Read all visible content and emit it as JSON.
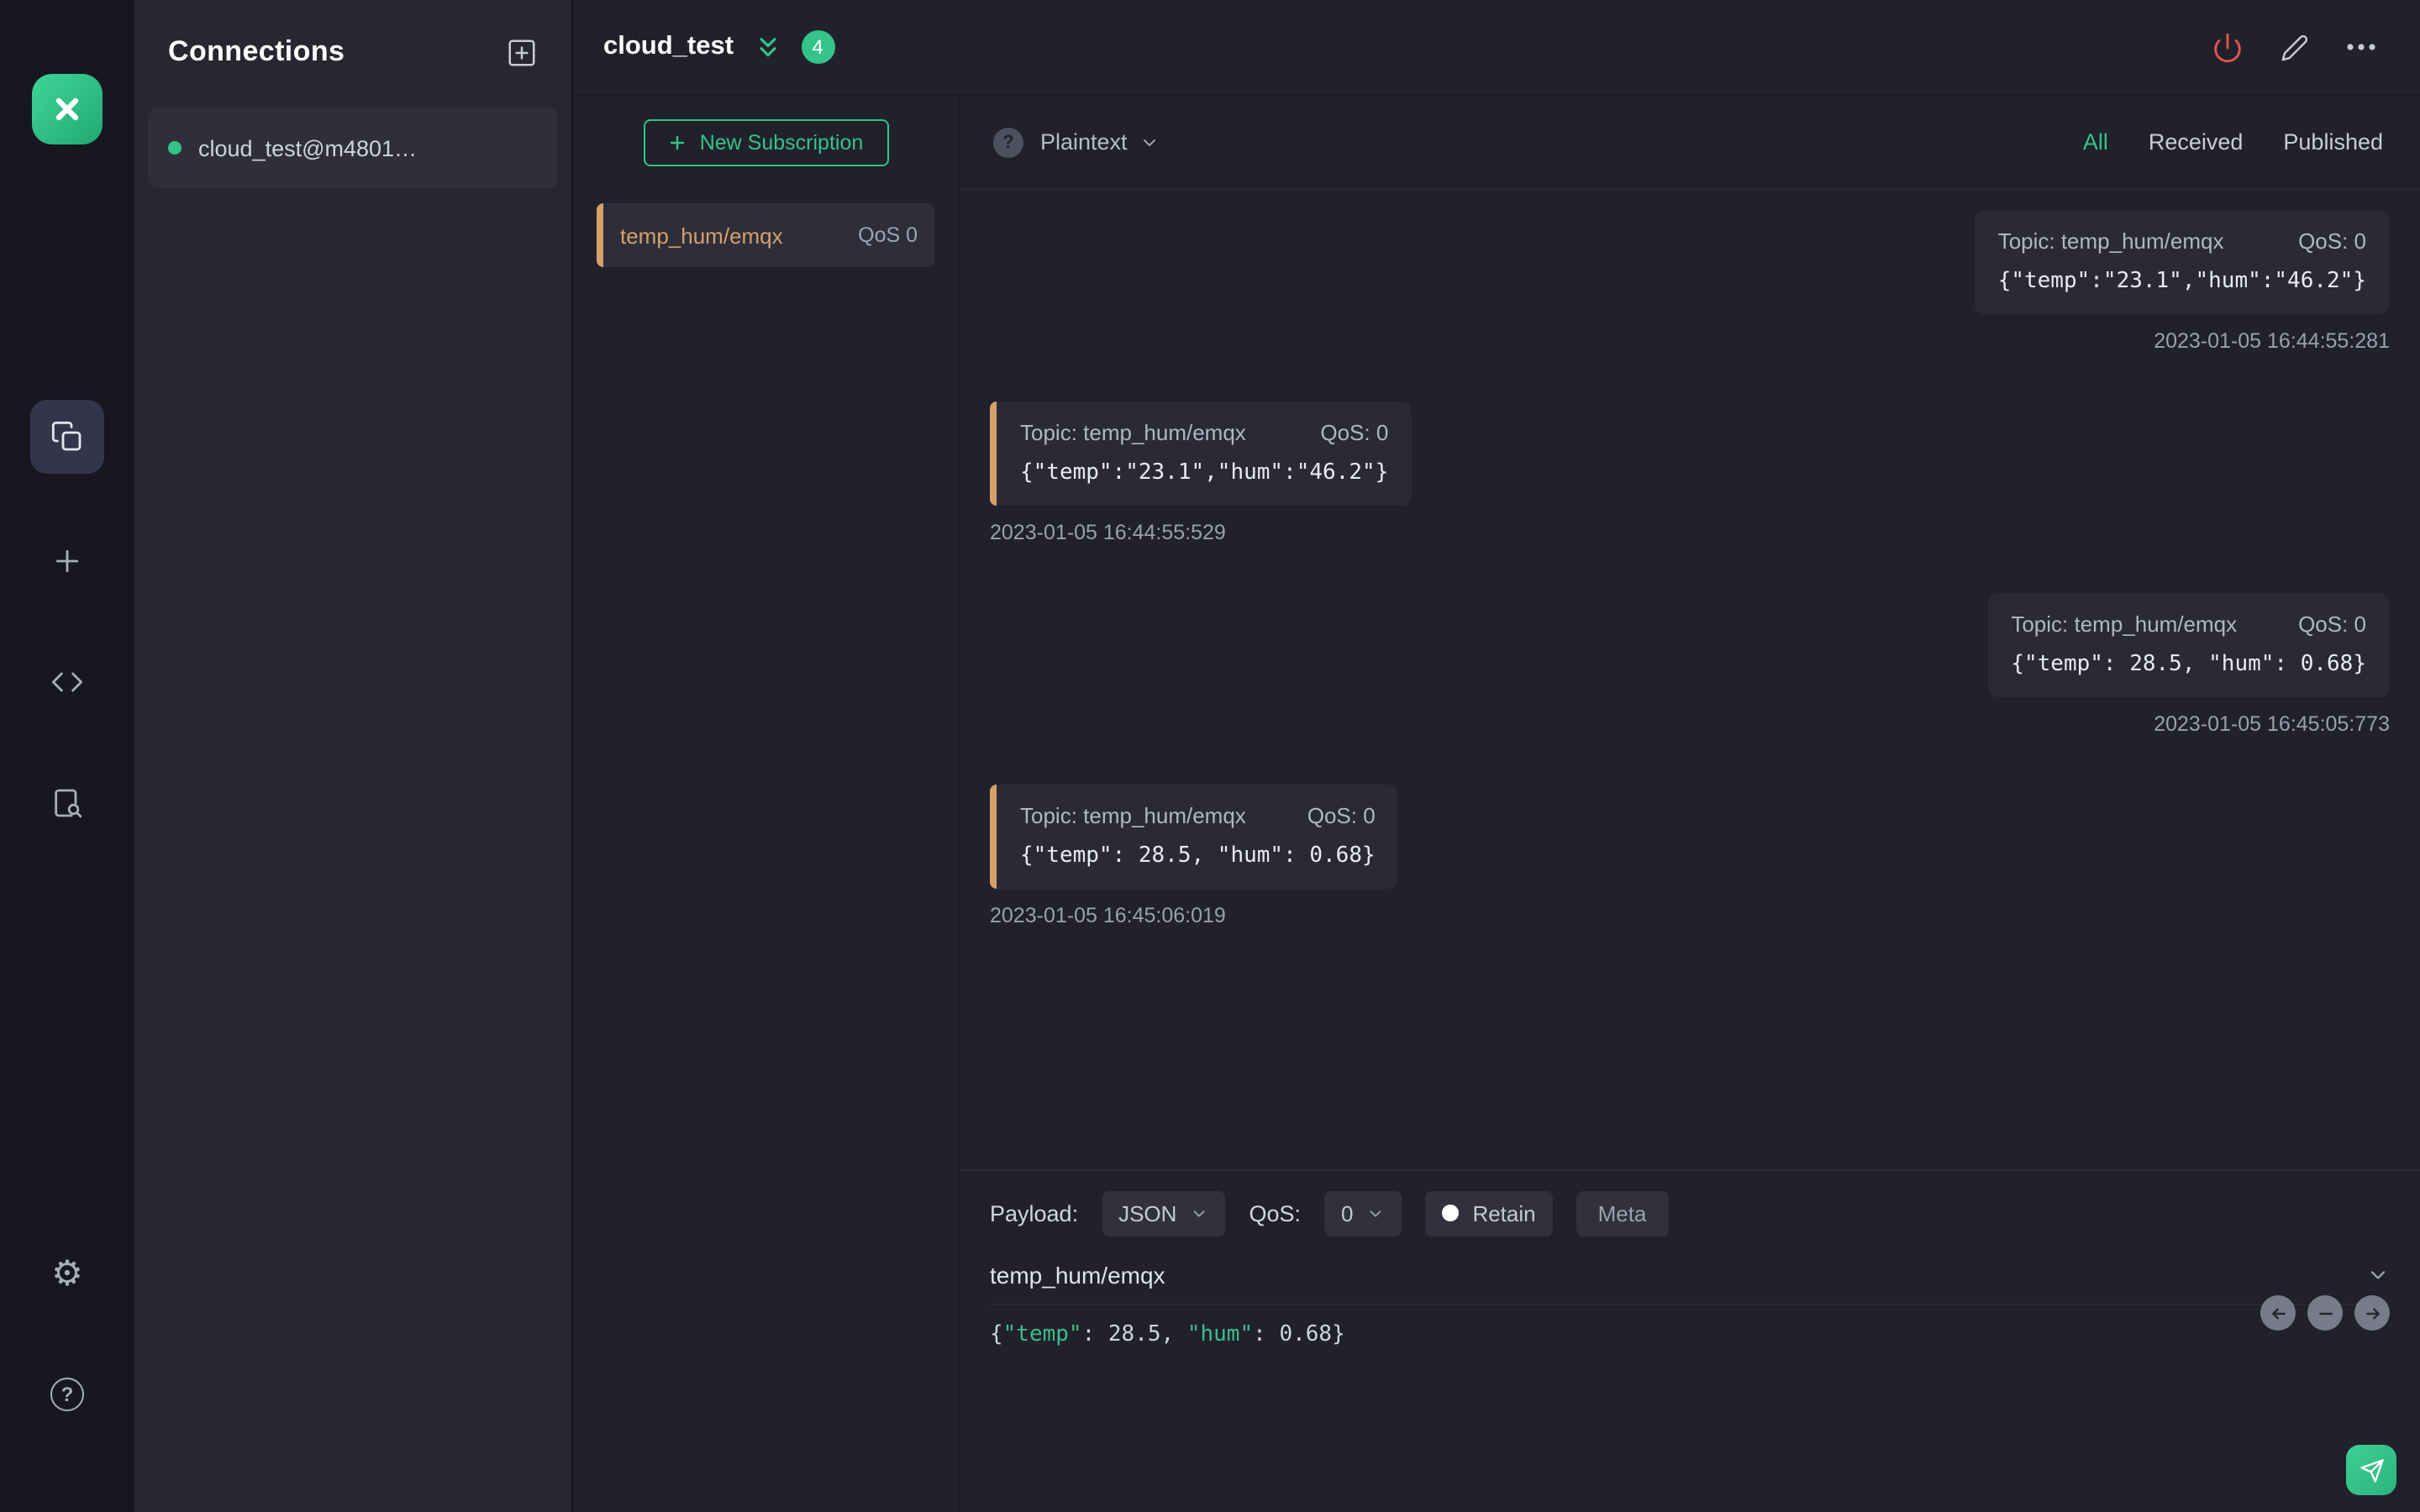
{
  "connections_panel": {
    "title": "Connections",
    "items": [
      {
        "name": "cloud_test@m4801…",
        "status": "connected"
      }
    ]
  },
  "topbar": {
    "title": "cloud_test",
    "unread_badge": "4"
  },
  "subscriptions": {
    "new_button_label": "New Subscription",
    "items": [
      {
        "topic": "temp_hum/emqx",
        "qos": "QoS 0"
      }
    ]
  },
  "messages_panel": {
    "payload_format": "Plaintext",
    "help_glyph": "?",
    "filters": {
      "all": "All",
      "received": "Received",
      "published": "Published"
    },
    "active_filter": "All",
    "items": [
      {
        "direction": "published",
        "topic_label": "Topic: temp_hum/emqx",
        "qos_label": "QoS: 0",
        "payload": "{\"temp\":\"23.1\",\"hum\":\"46.2\"}",
        "timestamp": "2023-01-05 16:44:55:281"
      },
      {
        "direction": "received",
        "topic_label": "Topic: temp_hum/emqx",
        "qos_label": "QoS: 0",
        "payload": "{\"temp\":\"23.1\",\"hum\":\"46.2\"}",
        "timestamp": "2023-01-05 16:44:55:529"
      },
      {
        "direction": "published",
        "topic_label": "Topic: temp_hum/emqx",
        "qos_label": "QoS: 0",
        "payload": "{\"temp\": 28.5, \"hum\": 0.68}",
        "timestamp": "2023-01-05 16:45:05:773"
      },
      {
        "direction": "received",
        "topic_label": "Topic: temp_hum/emqx",
        "qos_label": "QoS: 0",
        "payload": "{\"temp\": 28.5, \"hum\": 0.68}",
        "timestamp": "2023-01-05 16:45:06:019"
      }
    ]
  },
  "publish": {
    "payload_label": "Payload:",
    "format_value": "JSON",
    "qos_label": "QoS:",
    "qos_value": "0",
    "retain_label": "Retain",
    "meta_label": "Meta",
    "topic_value": "temp_hum/emqx",
    "payload_tokens": {
      "open": "{",
      "key1": "\"temp\"",
      "sep1": ": ",
      "val1": "28.5",
      "comma": ", ",
      "key2": "\"hum\"",
      "sep2": ": ",
      "val2": "0.68",
      "close": "}"
    }
  },
  "colors": {
    "accent_green": "#34c388",
    "accent_orange": "#d6a06a",
    "power_red": "#e2574d"
  }
}
